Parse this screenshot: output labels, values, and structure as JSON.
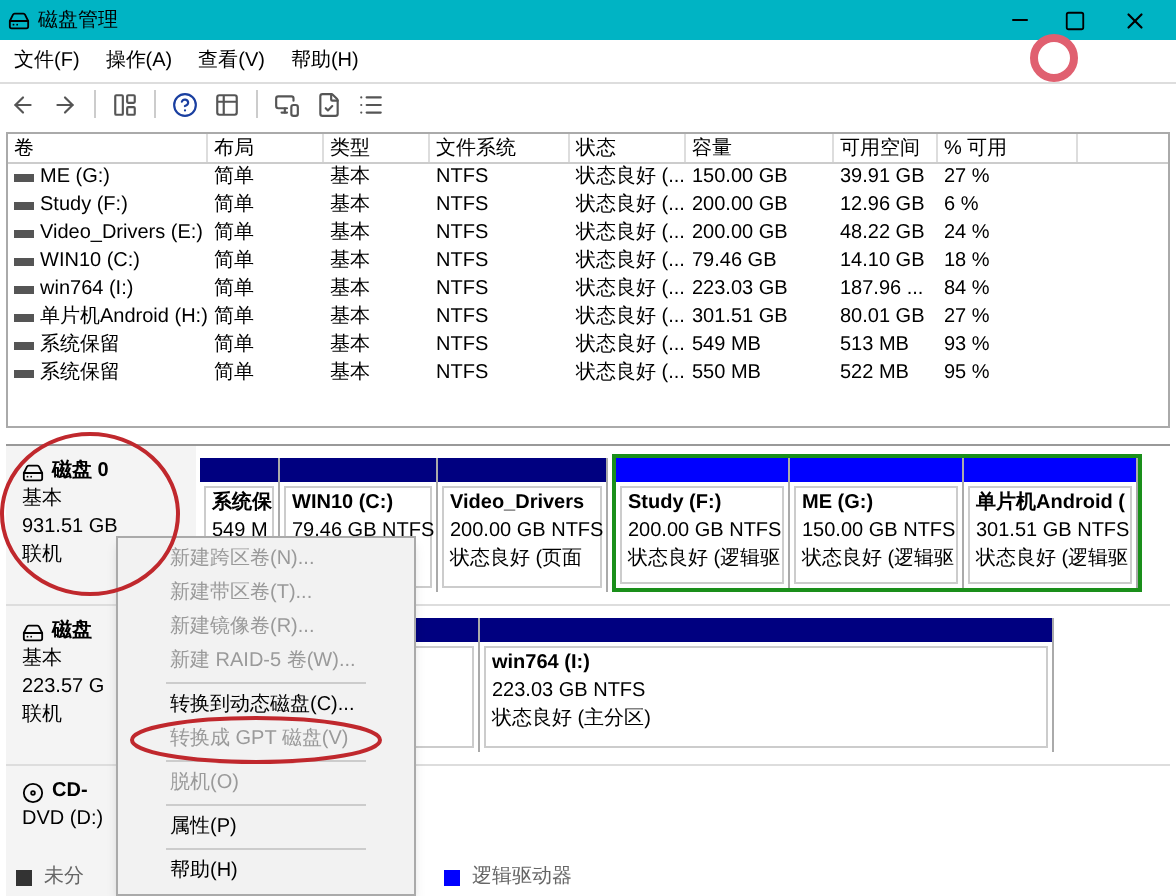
{
  "window": {
    "title": "磁盘管理"
  },
  "menu": [
    "文件(F)",
    "操作(A)",
    "查看(V)",
    "帮助(H)"
  ],
  "table": {
    "columns": [
      "卷",
      "布局",
      "类型",
      "文件系统",
      "状态",
      "容量",
      "可用空间",
      "% 可用"
    ],
    "rows": [
      [
        "ME (G:)",
        "简单",
        "基本",
        "NTFS",
        "状态良好 (...",
        "150.00 GB",
        "39.91 GB",
        "27 %"
      ],
      [
        "Study (F:)",
        "简单",
        "基本",
        "NTFS",
        "状态良好 (...",
        "200.00 GB",
        "12.96 GB",
        "6 %"
      ],
      [
        "Video_Drivers (E:)",
        "简单",
        "基本",
        "NTFS",
        "状态良好 (...",
        "200.00 GB",
        "48.22 GB",
        "24 %"
      ],
      [
        "WIN10 (C:)",
        "简单",
        "基本",
        "NTFS",
        "状态良好 (...",
        "79.46 GB",
        "14.10 GB",
        "18 %"
      ],
      [
        "win764 (I:)",
        "简单",
        "基本",
        "NTFS",
        "状态良好 (...",
        "223.03 GB",
        "187.96 ...",
        "84 %"
      ],
      [
        "单片机Android (H:)",
        "简单",
        "基本",
        "NTFS",
        "状态良好 (...",
        "301.51 GB",
        "80.01 GB",
        "27 %"
      ],
      [
        "系统保留",
        "简单",
        "基本",
        "NTFS",
        "状态良好 (...",
        "549 MB",
        "513 MB",
        "93 %"
      ],
      [
        "系统保留",
        "简单",
        "基本",
        "NTFS",
        "状态良好 (...",
        "550 MB",
        "522 MB",
        "95 %"
      ]
    ]
  },
  "disks": [
    {
      "kind": "disk",
      "name": "磁盘 0",
      "type": "基本",
      "size": "931.51 GB",
      "status": "联机",
      "partitions": [
        {
          "kind": "primary",
          "name": "系统保",
          "lines": [
            "549 M"
          ]
        },
        {
          "kind": "primary",
          "name": "WIN10  (C:)",
          "lines": [
            "79.46 GB NTFS"
          ]
        },
        {
          "kind": "primary",
          "name": "Video_Drivers",
          "lines": [
            "200.00 GB NTFS",
            "状态良好 (页面"
          ]
        },
        {
          "kind": "extended",
          "children": [
            {
              "kind": "logical",
              "name": "Study  (F:)",
              "lines": [
                "200.00 GB NTFS",
                "状态良好 (逻辑驱"
              ]
            },
            {
              "kind": "logical",
              "name": "ME  (G:)",
              "lines": [
                "150.00 GB NTFS",
                "状态良好 (逻辑驱"
              ]
            },
            {
              "kind": "logical",
              "name": "单片机Android  (",
              "lines": [
                "301.51 GB NTFS",
                "状态良好 (逻辑驱"
              ]
            }
          ]
        }
      ]
    },
    {
      "kind": "disk",
      "name": "磁盘",
      "type": "基本",
      "size": "223.57 G",
      "status": "联机",
      "partitions": [
        {
          "kind": "primary"
        },
        {
          "kind": "primary",
          "name": "win764  (I:)",
          "lines": [
            "223.03 GB NTFS",
            "状态良好 (主分区)"
          ]
        }
      ]
    },
    {
      "kind": "cdrom",
      "name": "CD-",
      "type": "DVD (D:)"
    }
  ],
  "legend": [
    {
      "label": "未分",
      "color": "#333333"
    },
    {
      "label": "逻辑驱动器",
      "color": "#0000ff"
    }
  ],
  "context_menu": [
    {
      "kind": "item",
      "label": "新建跨区卷(N)...",
      "disabled": true
    },
    {
      "kind": "item",
      "label": "新建带区卷(T)...",
      "disabled": true
    },
    {
      "kind": "item",
      "label": "新建镜像卷(R)...",
      "disabled": true
    },
    {
      "kind": "item",
      "label": "新建 RAID-5 卷(W)...",
      "disabled": true
    },
    {
      "kind": "separator"
    },
    {
      "kind": "item",
      "label": "转换到动态磁盘(C)...",
      "disabled": false
    },
    {
      "kind": "item",
      "label": "转换成 GPT 磁盘(V)",
      "disabled": true
    },
    {
      "kind": "separator"
    },
    {
      "kind": "item",
      "label": "脱机(O)",
      "disabled": true
    },
    {
      "kind": "separator"
    },
    {
      "kind": "item",
      "label": "属性(P)",
      "disabled": false
    },
    {
      "kind": "separator"
    },
    {
      "kind": "item",
      "label": "帮助(H)",
      "disabled": false
    }
  ]
}
